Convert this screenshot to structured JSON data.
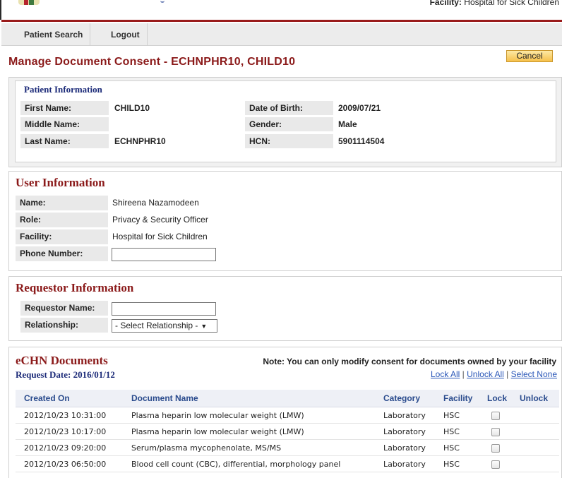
{
  "header": {
    "facility_label": "Facility:",
    "facility_value": "Hospital for Sick Children"
  },
  "nav": [
    {
      "label": "Patient Search"
    },
    {
      "label": "Logout"
    }
  ],
  "page": {
    "title": "Manage Document Consent - ECHNPHR10, CHILD10",
    "cancel_label": "Cancel"
  },
  "patient": {
    "heading": "Patient Information",
    "first_name_label": "First Name:",
    "first_name": "CHILD10",
    "middle_name_label": "Middle Name:",
    "middle_name": "",
    "last_name_label": "Last Name:",
    "last_name": "ECHNPHR10",
    "dob_label": "Date of Birth:",
    "dob": "2009/07/21",
    "gender_label": "Gender:",
    "gender": "Male",
    "hcn_label": "HCN:",
    "hcn": "5901114504"
  },
  "user": {
    "heading": "User Information",
    "name_label": "Name:",
    "name": "Shireena Nazamodeen",
    "role_label": "Role:",
    "role": "Privacy & Security Officer",
    "facility_label": "Facility:",
    "facility": "Hospital for Sick Children",
    "phone_label": "Phone Number:",
    "phone_value": ""
  },
  "requestor": {
    "heading": "Requestor Information",
    "name_label": "Requestor Name:",
    "name_value": "",
    "relationship_label": "Relationship:",
    "relationship_selected": "- Select Relationship -"
  },
  "documents": {
    "heading": "eCHN Documents",
    "request_date": "Request Date: 2016/01/12",
    "note": "Note: You can only modify consent for documents owned by your facility",
    "lock_all": "Lock All",
    "unlock_all": "Unlock All",
    "select_none": "Select None",
    "separator": " | ",
    "columns": [
      "Created On",
      "Document Name",
      "Category",
      "Facility",
      "Lock",
      "Unlock"
    ],
    "rows": [
      {
        "created": "2012/10/23 10:31:00",
        "name": "Plasma heparin low molecular weight (LMW)",
        "category": "Laboratory",
        "facility": "HSC",
        "locked": false
      },
      {
        "created": "2012/10/23 10:17:00",
        "name": "Plasma heparin low molecular weight (LMW)",
        "category": "Laboratory",
        "facility": "HSC",
        "locked": false
      },
      {
        "created": "2012/10/23 09:20:00",
        "name": "Serum/plasma mycophenolate, MS/MS",
        "category": "Laboratory",
        "facility": "HSC",
        "locked": false
      },
      {
        "created": "2012/10/23 06:50:00",
        "name": "Blood cell count (CBC), differential, morphology panel",
        "category": "Laboratory",
        "facility": "HSC",
        "locked": false
      }
    ]
  }
}
